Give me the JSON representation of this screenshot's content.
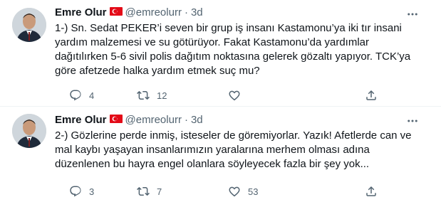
{
  "tweets": [
    {
      "author_name": "Emre Olur",
      "handle": "@emreolurr",
      "separator": "·",
      "time": "3d",
      "text": "1-) Sn. Sedat PEKER’i seven bir grup iş insanı Kastamonu’ya iki tır insani\nyardım malzemesi ve su götürüyor. Fakat Kastamonu’da yardımlar\ndağıtılırken 5-6 sivil polis dağıtım noktasına gelerek gözaltı yapıyor. TCK’ya\ngöre afetzede halka yardım etmek suç mu?",
      "reply_count": "4",
      "retweet_count": "12",
      "like_count": ""
    },
    {
      "author_name": "Emre Olur",
      "handle": "@emreolurr",
      "separator": "·",
      "time": "3d",
      "text": "2-) Gözlerine perde inmiş, isteseler de göremiyorlar. Yazık! Afetlerde can ve\nmal kaybı yaşayan insanlarımızın yaralarına merhem olması adına\ndüzenlenen bu hayra engel olanlara söyleyecek fazla bir şey yok...",
      "reply_count": "3",
      "retweet_count": "7",
      "like_count": "53"
    }
  ],
  "icons": {
    "flag": "turkey-flag-icon",
    "more": "more-options-icon",
    "reply": "reply-icon",
    "retweet": "retweet-icon",
    "like": "heart-icon",
    "share": "share-icon"
  },
  "colors": {
    "text": "#0f1419",
    "secondary": "#536471",
    "divider": "#eff3f4",
    "flag_red": "#e30a17"
  }
}
